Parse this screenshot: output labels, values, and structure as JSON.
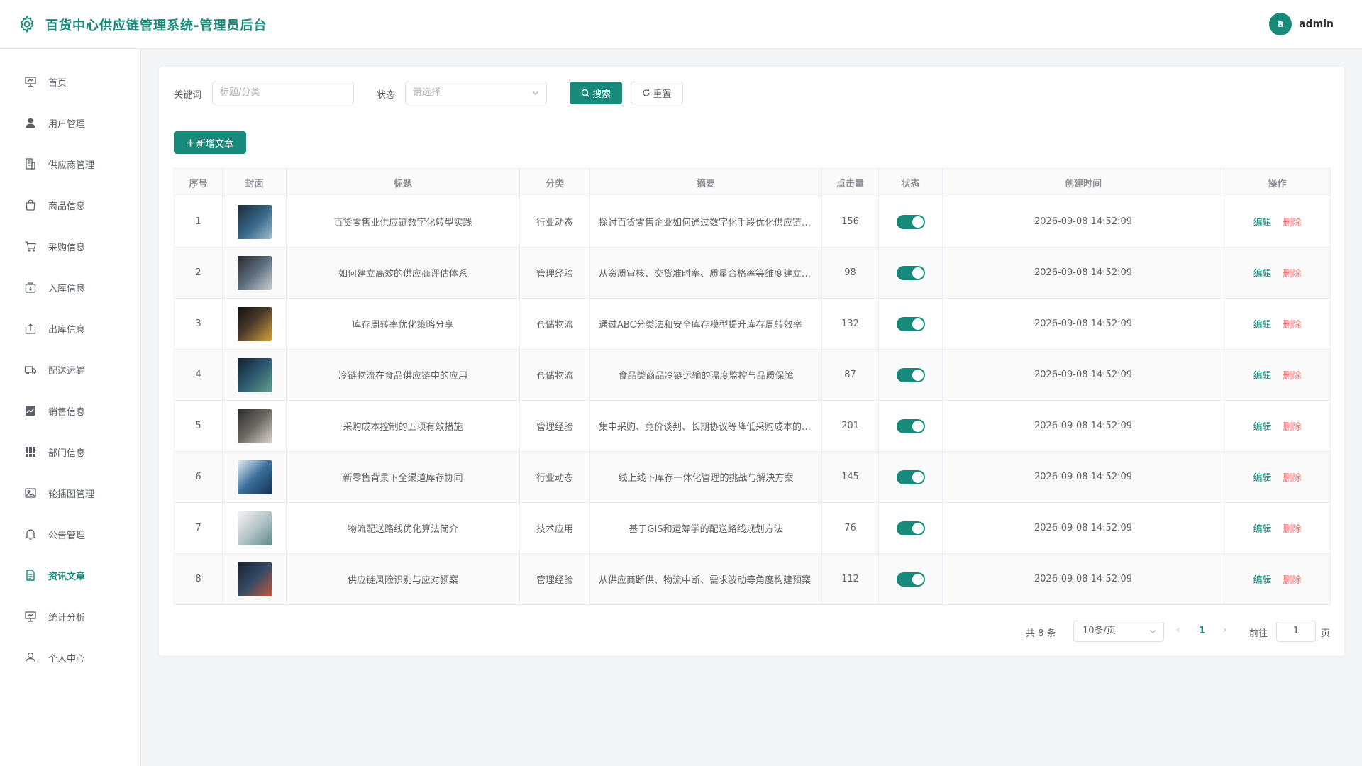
{
  "header": {
    "title": "百货中心供应链管理系统-管理员后台",
    "avatar_letter": "a",
    "username": "admin",
    "brand_color": "#178a7c"
  },
  "sidebar": {
    "items": [
      {
        "label": "首页",
        "icon": "presentation-icon"
      },
      {
        "label": "用户管理",
        "icon": "user-icon"
      },
      {
        "label": "供应商管理",
        "icon": "building-icon"
      },
      {
        "label": "商品信息",
        "icon": "shopping-bag-icon"
      },
      {
        "label": "采购信息",
        "icon": "cart-icon"
      },
      {
        "label": "入库信息",
        "icon": "box-in-icon"
      },
      {
        "label": "出库信息",
        "icon": "box-out-icon"
      },
      {
        "label": "配送运输",
        "icon": "truck-icon"
      },
      {
        "label": "销售信息",
        "icon": "trend-chart-icon"
      },
      {
        "label": "部门信息",
        "icon": "grid-icon"
      },
      {
        "label": "轮播图管理",
        "icon": "picture-icon"
      },
      {
        "label": "公告管理",
        "icon": "bell-icon"
      },
      {
        "label": "资讯文章",
        "icon": "document-icon",
        "active": true
      },
      {
        "label": "统计分析",
        "icon": "data-board-icon"
      },
      {
        "label": "个人中心",
        "icon": "user-outline-icon"
      }
    ]
  },
  "search": {
    "keyword_label": "关键词",
    "keyword_placeholder": "标题/分类",
    "status_label": "状态",
    "status_placeholder": "请选择",
    "search_button": "搜索",
    "reset_button": "重置"
  },
  "toolbar": {
    "add_button": "新增文章"
  },
  "table": {
    "columns": [
      "序号",
      "封面",
      "标题",
      "分类",
      "摘要",
      "点击量",
      "状态",
      "创建时间",
      "操作"
    ],
    "edit_label": "编辑",
    "delete_label": "删除",
    "rows": [
      {
        "index": "1",
        "title": "百货零售业供应链数字化转型实践",
        "category": "行业动态",
        "summary": "探讨百货零售企业如何通过数字化手段优化供应链管理",
        "clicks": "156",
        "status": true,
        "created": "2026-09-08 14:52:09"
      },
      {
        "index": "2",
        "title": "如何建立高效的供应商评估体系",
        "category": "管理经验",
        "summary": "从资质审核、交货准时率、质量合格率等维度建立评估体系",
        "clicks": "98",
        "status": true,
        "created": "2026-09-08 14:52:09"
      },
      {
        "index": "3",
        "title": "库存周转率优化策略分享",
        "category": "仓储物流",
        "summary": "通过ABC分类法和安全库存模型提升库存周转效率",
        "clicks": "132",
        "status": true,
        "created": "2026-09-08 14:52:09"
      },
      {
        "index": "4",
        "title": "冷链物流在食品供应链中的应用",
        "category": "仓储物流",
        "summary": "食品类商品冷链运输的温度监控与品质保障",
        "clicks": "87",
        "status": true,
        "created": "2026-09-08 14:52:09"
      },
      {
        "index": "5",
        "title": "采购成本控制的五项有效措施",
        "category": "管理经验",
        "summary": "集中采购、竞价谈判、长期协议等降低采购成本的方法",
        "clicks": "201",
        "status": true,
        "created": "2026-09-08 14:52:09"
      },
      {
        "index": "6",
        "title": "新零售背景下全渠道库存协同",
        "category": "行业动态",
        "summary": "线上线下库存一体化管理的挑战与解决方案",
        "clicks": "145",
        "status": true,
        "created": "2026-09-08 14:52:09"
      },
      {
        "index": "7",
        "title": "物流配送路线优化算法简介",
        "category": "技术应用",
        "summary": "基于GIS和运筹学的配送路线规划方法",
        "clicks": "76",
        "status": true,
        "created": "2026-09-08 14:52:09"
      },
      {
        "index": "8",
        "title": "供应链风险识别与应对预案",
        "category": "管理经验",
        "summary": "从供应商断供、物流中断、需求波动等角度构建预案",
        "clicks": "112",
        "status": true,
        "created": "2026-09-08 14:52:09"
      }
    ]
  },
  "pagination": {
    "total_text": "共 8 条",
    "page_size": "10条/页",
    "current_page": "1",
    "goto_label": "前往",
    "goto_value": "1",
    "page_suffix": "页"
  }
}
